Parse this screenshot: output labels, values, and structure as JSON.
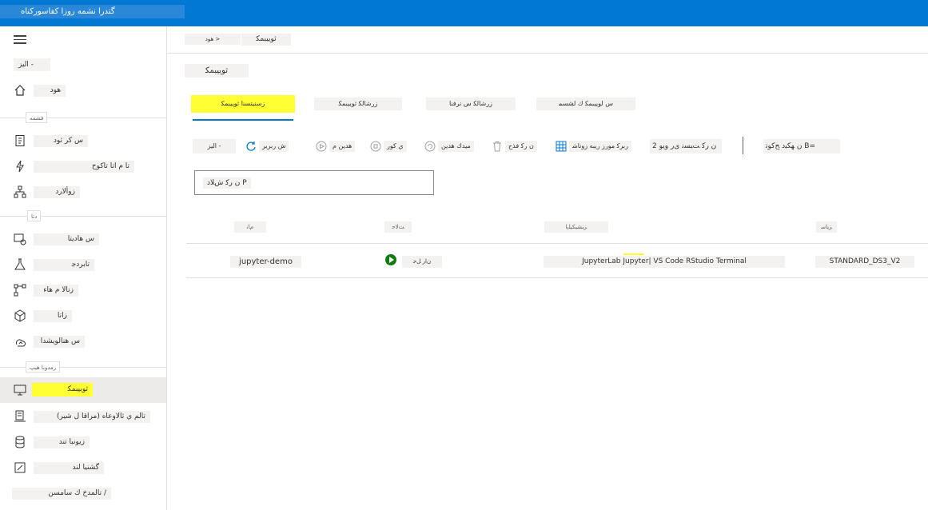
{
  "app": {
    "title": "ﮔﺘﺪﺭﺍ ﻧﺸﻤﻪ ﺭﻭﺯﺍ ﮐﻔﺎﺳﻮﺭﮐﻨﺎﻩ"
  },
  "sidebar": {
    "new_label": "ﺍﻟﯿﺰ -",
    "home_label": "ﻫﻮﺩ",
    "section1": "ﻓﺸﻤﻪ",
    "section2": "ﺩﺗﺎ",
    "section3": "ﺭﻣﺪﻭﻧﺎ ﻫﯿﭗ",
    "items": [
      {
        "label": "ﺱ ﻛﺮ ﺛﻮﺩ",
        "icon": "notebook-icon"
      },
      {
        "label": "ﺗﺎ ﻡ ﺍﺗﺎ ﺗﺎﮐﻮﺡ",
        "icon": "automl-icon"
      },
      {
        "label": "ﺯﻭﺃﻟﺎﺭﺩ",
        "icon": "designer-icon"
      },
      {
        "label": "ﺱ ﻫﺎﺩﻳﺘﺎ",
        "icon": "datasets-icon"
      },
      {
        "label": "ﺗﺎﺑﺮﺩﺟ",
        "icon": "experiments-icon"
      },
      {
        "label": "ﺯﻧﺎﻟﺎ ﻡ ﻫﺎﺀ",
        "icon": "pipelines-icon"
      },
      {
        "label": "ﺯﺍﺗﺎ",
        "icon": "models-icon"
      },
      {
        "label": "ﺱ ﻫﻨﺎﻟﻮﻳﺸﺪﺍ",
        "icon": "endpoints-icon"
      },
      {
        "label": "ﺛﻮﻳﻴﺒﻤﻜ",
        "icon": "compute-icon"
      },
      {
        "label": "(ﻣﺮﺍﻗﺎ ﻝ ﺷﻴﺮ) ﺗﺎﻟﻢ ﻱ ﺛﺎﻟﺎﻭﻋﺎﻩ",
        "icon": "environments-icon"
      },
      {
        "label": "ﺯﻳﻮﻧﺒﺎ ﺗﻨﺪ",
        "icon": "datastores-icon"
      },
      {
        "label": "ﮔﺸﻨﻴﺎ ﻟﻨﺪ",
        "icon": "labeling-icon"
      },
      {
        "label": "ﺗﺎﻟﻤﺪﺥ ﻙ ﺳﺎﻣﺴﻦ /",
        "icon": "linked-services-icon"
      }
    ]
  },
  "header": {
    "breadcrumb_home": "ﻫﻮﺩ >",
    "breadcrumb_current": "ﺛﻮﻳﻴﺒﻤﻜ",
    "page_title": "ﺛﻮﻳﻴﺒﻤﻜ"
  },
  "tabs": [
    {
      "label": "ﺯﺳﻨﻴﺘﺴﻨﺍ ﺛﻮﻳﻴﺒﻤﻜ",
      "active": true
    },
    {
      "label": "ﺯﺭﺷﺎﻟﻜ ﺛﻮﻳﻴﺒﻤﻜ",
      "active": false
    },
    {
      "label": "ﺯﺭﺷﺎﻟﻜ ﺱ ﻧﺮﻓﻨﺎ",
      "active": false
    },
    {
      "label": "ﺱ ﻟﻮﻳﻴﺒﻤﻜ ﻙ ﻟﺸﺴﻤ",
      "active": false
    }
  ],
  "toolbar": {
    "new": "ﺍﻟﻴﺰ -",
    "refresh": "ﺵ ﺭﺑﺮﻳﺮ",
    "start": "ﻫﺪﻳﻦ ﻡ",
    "stop": "ﻱ ﻛﻮﺭ",
    "restart": "ﻣﻴﺪﻙ ﻫﺪﻳﻦ",
    "delete": "ﻥ ﺭﻛ ﻓﺬﺡ",
    "edit_columns": "ﺭﺑﺮﻛ ﻣﻮﺭﺯ ﺭﻳﺒﻪ ﺯﻭﻧﺎﺷ",
    "reset_view": "ﻥ ﺭﻛ ﺖﺒﺴﻧ ﯼﺭ ﻭﻳﻮ 2",
    "filter_group": "ﻥ ﻬﻜﺒﺩ ﺢﻛﻮﺗ B="
  },
  "filter": {
    "placeholder": "ﻥ ﺭﻛ ﺵﻼﺩ P"
  },
  "table": {
    "headers": {
      "name": "ﻡﺎﻧ",
      "state": "ﺖﻟﺎﺣ",
      "apps": "ﺰﻨﺸﻴﻜﻴﻠﭘﺍ",
      "size": "ﺰﻳﺎﺳ"
    },
    "rows": [
      {
        "name": "jupyter-demo",
        "state": "ﻥﺍﺭ ﻞﺣ",
        "apps": "JupyterLab Jupyter| VS Code RStudio Terminal",
        "size": "STANDARD_DS3_V2"
      }
    ]
  },
  "colors": {
    "accent": "#0078d4",
    "highlight": "#ffff33",
    "running": "#107c10"
  }
}
